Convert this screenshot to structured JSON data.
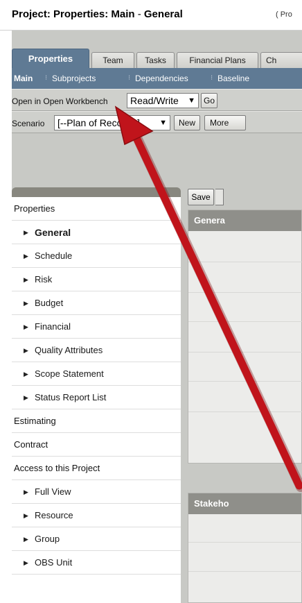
{
  "window": {
    "title_main": "Project: Properties: Main",
    "title_sep": " - ",
    "title_page": "General",
    "title_suffix": "( Pro"
  },
  "tabs": [
    {
      "label": "Properties",
      "active": true
    },
    {
      "label": "Team"
    },
    {
      "label": "Tasks"
    },
    {
      "label": "Financial Plans"
    },
    {
      "label": "Ch"
    }
  ],
  "subnav": {
    "items": [
      "Main",
      "Subprojects",
      "Dependencies",
      "Baseline"
    ],
    "separator": "⁝"
  },
  "workbench_bar": {
    "label": "Open in Open Workbench",
    "mode_value": "Read/Write",
    "go_label": "Go"
  },
  "scenario_bar": {
    "label": "Scenario",
    "value": "[--Plan of Record--]",
    "new_label": "New",
    "more_label": "More"
  },
  "leftnav": {
    "properties_label": "Properties",
    "properties_children": [
      "General",
      "Schedule",
      "Risk",
      "Budget",
      "Financial",
      "Quality Attributes",
      "Scope Statement",
      "Status Report List"
    ],
    "estimating_label": "Estimating",
    "contract_label": "Contract",
    "access_label": "Access to this Project",
    "access_children": [
      "Full View",
      "Resource",
      "Group",
      "OBS Unit"
    ],
    "caret": "▶"
  },
  "content": {
    "save_label": "Save",
    "general_header": "Genera",
    "stakeholders_header": "Stakeho"
  },
  "colors": {
    "accent": "#5f7a94",
    "panel": "#c8c9c5",
    "annotation_arrow": "#c0141b"
  }
}
